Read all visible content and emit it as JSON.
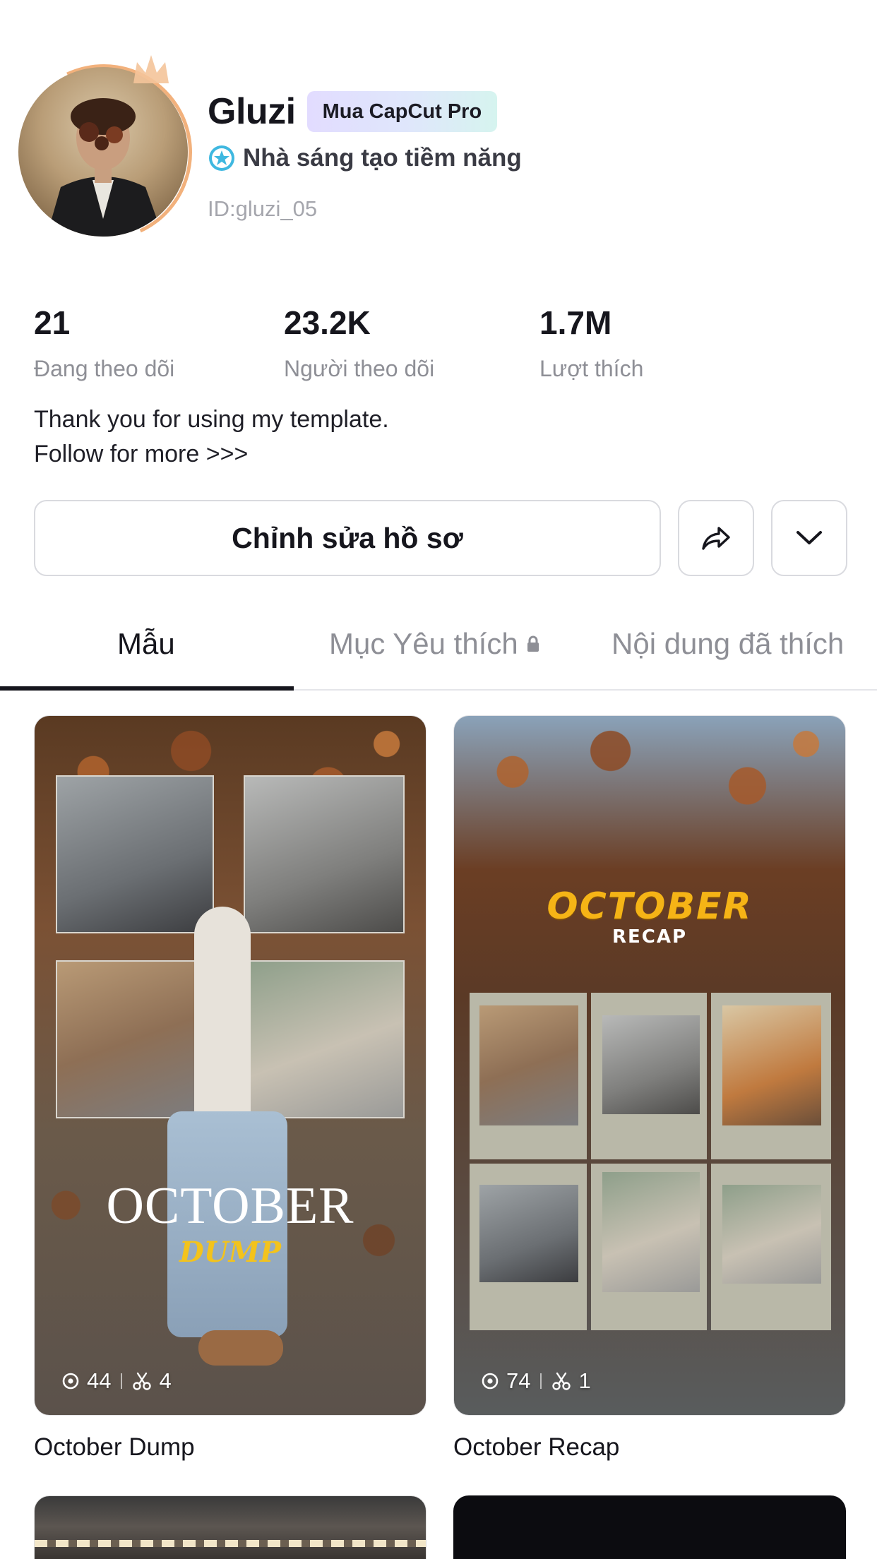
{
  "profile": {
    "name": "Gluzi",
    "pro_badge": "Mua CapCut Pro",
    "creator_label": "Nhà sáng tạo tiềm năng",
    "user_id": "ID:gluzi_05"
  },
  "stats": [
    {
      "value": "21",
      "label": "Đang theo dõi"
    },
    {
      "value": "23.2K",
      "label": "Người theo dõi"
    },
    {
      "value": "1.7M",
      "label": "Lượt thích"
    }
  ],
  "bio": {
    "line1": "Thank you for using my template.",
    "line2": "Follow for more >>>"
  },
  "actions": {
    "edit_label": "Chỉnh sửa hồ sơ",
    "share_icon": "share-arrow-icon",
    "more_icon": "chevron-down-icon"
  },
  "tabs": [
    {
      "label": "Mẫu",
      "active": true
    },
    {
      "label": "Mục Yêu thích",
      "locked": true
    },
    {
      "label": "Nội dung đã thích"
    }
  ],
  "templates": [
    {
      "name": "October Dump",
      "views": "44",
      "uses": "4",
      "overlay_title": "OCTOBER",
      "overlay_subtitle": "DUMP"
    },
    {
      "name": "October Recap",
      "views": "74",
      "uses": "1",
      "overlay_title": "OCTOBER",
      "overlay_subtitle": "RECAP"
    }
  ],
  "colors": {
    "badge_gradient_start": "#e2dcff",
    "badge_gradient_end": "#d6f4ef",
    "creator_icon": "#3fb8e0",
    "tab_active": "#16161d",
    "tab_inactive": "#8e8f96",
    "dump_script": "#f3c31c",
    "recap_yellow": "#f5b416"
  }
}
